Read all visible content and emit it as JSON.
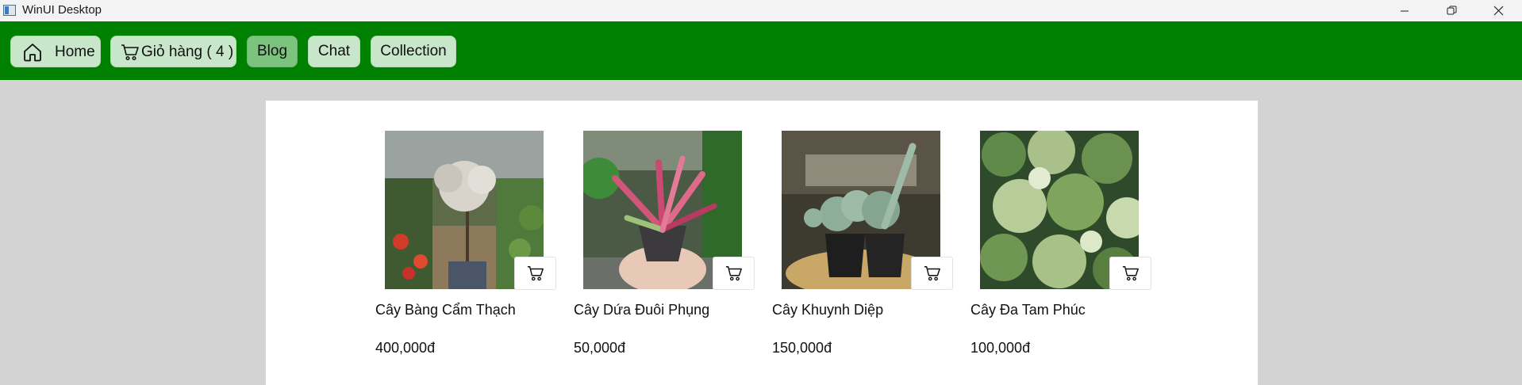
{
  "window": {
    "title": "WinUI Desktop"
  },
  "nav": {
    "home": "Home",
    "cart": "Giỏ hàng ( 4 )",
    "blog": "Blog",
    "chat": "Chat",
    "collection": "Collection"
  },
  "products": [
    {
      "name": "Cây Bàng Cẩm Thạch",
      "price": "400,000đ"
    },
    {
      "name": "Cây Dứa Đuôi Phụng",
      "price": "50,000đ"
    },
    {
      "name": "Cây Khuynh Diệp",
      "price": "150,000đ"
    },
    {
      "name": "Cây Đa Tam Phúc",
      "price": "100,000đ"
    }
  ],
  "colors": {
    "nav_background": "#008000",
    "nav_button": "#c8e6c9",
    "nav_button_selected": "#7cc37f",
    "page_background": "#d3d3d3"
  }
}
